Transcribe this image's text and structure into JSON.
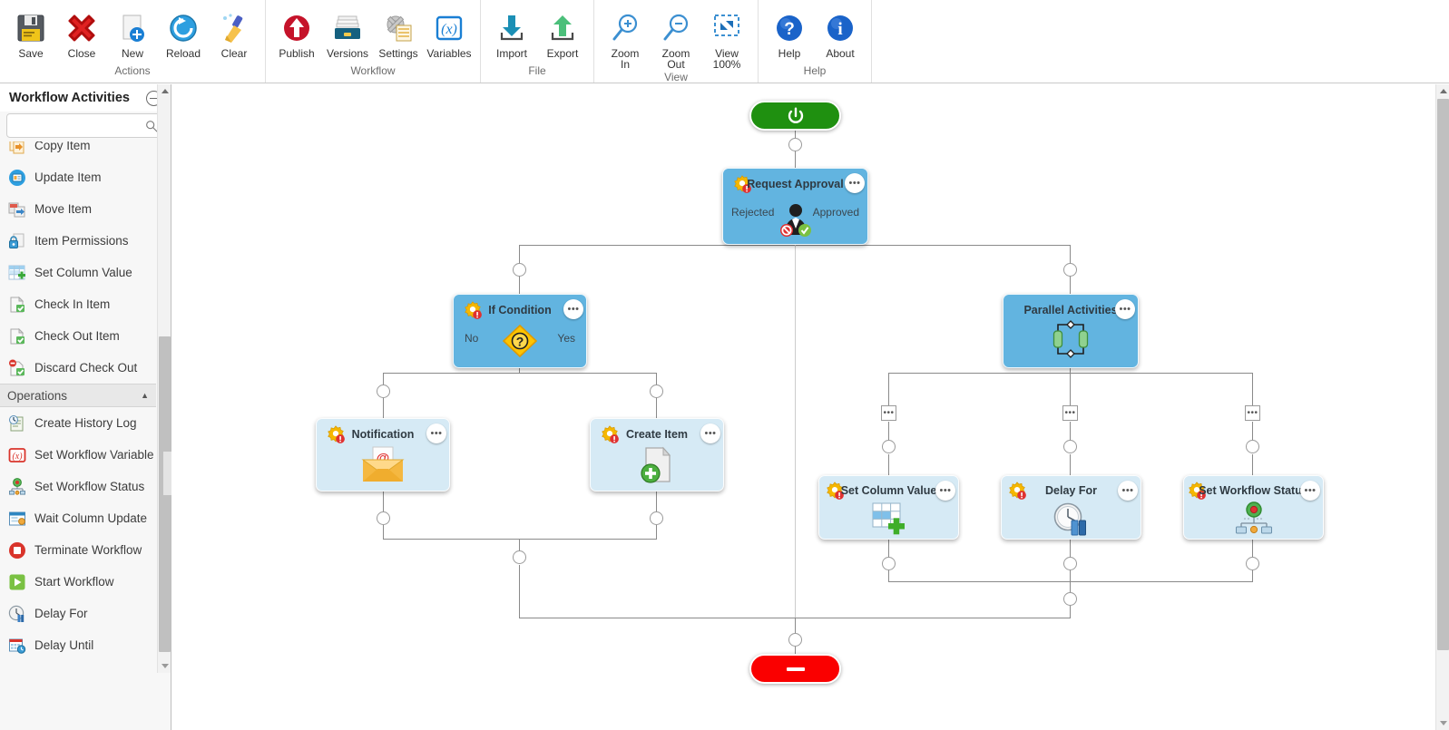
{
  "ribbon": {
    "groups": [
      {
        "name": "Actions",
        "label": "Actions",
        "buttons": [
          {
            "label": "Save",
            "icon": "save-icon"
          },
          {
            "label": "Close",
            "icon": "close-icon"
          },
          {
            "label": "New",
            "icon": "new-icon"
          },
          {
            "label": "Reload",
            "icon": "reload-icon"
          },
          {
            "label": "Clear",
            "icon": "clear-icon"
          }
        ]
      },
      {
        "name": "Workflow",
        "label": "Workflow",
        "buttons": [
          {
            "label": "Publish",
            "icon": "publish-icon"
          },
          {
            "label": "Versions",
            "icon": "versions-icon"
          },
          {
            "label": "Settings",
            "icon": "settings-icon"
          },
          {
            "label": "Variables",
            "icon": "variables-icon"
          }
        ]
      },
      {
        "name": "File",
        "label": "File",
        "buttons": [
          {
            "label": "Import",
            "icon": "import-icon"
          },
          {
            "label": "Export",
            "icon": "export-icon"
          }
        ]
      },
      {
        "name": "View",
        "label": "View",
        "buttons": [
          {
            "label": "Zoom\nIn",
            "icon": "zoom-in-icon"
          },
          {
            "label": "Zoom\nOut",
            "icon": "zoom-out-icon"
          },
          {
            "label": "View\n100%",
            "icon": "view-100-icon"
          }
        ]
      },
      {
        "name": "Help",
        "label": "Help",
        "buttons": [
          {
            "label": "Help",
            "icon": "help-icon"
          },
          {
            "label": "About",
            "icon": "about-icon"
          }
        ]
      }
    ]
  },
  "sidebar": {
    "title": "Workflow Activities",
    "search": {
      "value": "",
      "placeholder": ""
    },
    "items": [
      {
        "label": "Copy Item",
        "icon": "copy-item-icon",
        "type": "item"
      },
      {
        "label": "Update Item",
        "icon": "update-item-icon",
        "type": "item"
      },
      {
        "label": "Move Item",
        "icon": "move-item-icon",
        "type": "item"
      },
      {
        "label": "Item Permissions",
        "icon": "item-permissions-icon",
        "type": "item"
      },
      {
        "label": "Set Column Value",
        "icon": "set-column-value-icon",
        "type": "item"
      },
      {
        "label": "Check In Item",
        "icon": "check-in-item-icon",
        "type": "item"
      },
      {
        "label": "Check Out Item",
        "icon": "check-out-item-icon",
        "type": "item"
      },
      {
        "label": "Discard Check Out",
        "icon": "discard-check-out-icon",
        "type": "item"
      },
      {
        "label": "Operations",
        "icon": "collapse-caret-icon",
        "type": "group"
      },
      {
        "label": "Create History Log",
        "icon": "create-history-log-icon",
        "type": "item"
      },
      {
        "label": "Set Workflow Variable",
        "icon": "set-workflow-variable-icon",
        "type": "item"
      },
      {
        "label": "Set Workflow Status",
        "icon": "set-workflow-status-icon",
        "type": "item"
      },
      {
        "label": "Wait Column Update",
        "icon": "wait-column-update-icon",
        "type": "item"
      },
      {
        "label": "Terminate Workflow",
        "icon": "terminate-workflow-icon",
        "type": "item"
      },
      {
        "label": "Start Workflow",
        "icon": "start-workflow-icon",
        "type": "item"
      },
      {
        "label": "Delay For",
        "icon": "delay-for-icon",
        "type": "item"
      },
      {
        "label": "Delay Until",
        "icon": "delay-until-icon",
        "type": "item"
      }
    ]
  },
  "canvas": {
    "start_node": {
      "name": "start",
      "icon": "power-icon",
      "color": "#1f9010"
    },
    "stop_node": {
      "name": "stop",
      "icon": "stop-icon",
      "color": "#fa0000"
    },
    "menu_glyph": "•••",
    "nodes": [
      {
        "id": "request-approval",
        "title": "Request Approval",
        "icon": "request-approval-icon",
        "selected": true,
        "has_warning": true,
        "left_label": "Rejected",
        "right_label": "Approved"
      },
      {
        "id": "if-condition",
        "title": "If Condition",
        "icon": "if-condition-icon",
        "selected": true,
        "has_warning": true,
        "left_label": "No",
        "right_label": "Yes"
      },
      {
        "id": "parallel-activities",
        "title": "Parallel Activities",
        "icon": "parallel-activities-icon",
        "selected": true,
        "has_warning": false,
        "left_label": "",
        "right_label": ""
      },
      {
        "id": "notification",
        "title": "Notification",
        "icon": "notification-icon",
        "selected": false,
        "has_warning": true,
        "left_label": "",
        "right_label": ""
      },
      {
        "id": "create-item",
        "title": "Create Item",
        "icon": "create-item-icon",
        "selected": false,
        "has_warning": true,
        "left_label": "",
        "right_label": ""
      },
      {
        "id": "set-column-value",
        "title": "Set Column Value",
        "icon": "set-column-value-icon",
        "selected": false,
        "has_warning": true,
        "left_label": "",
        "right_label": ""
      },
      {
        "id": "delay-for",
        "title": "Delay For",
        "icon": "delay-for-icon",
        "selected": false,
        "has_warning": true,
        "left_label": "",
        "right_label": ""
      },
      {
        "id": "set-workflow-status",
        "title": "Set Workflow Status",
        "icon": "set-workflow-status-icon",
        "selected": false,
        "has_warning": true,
        "left_label": "",
        "right_label": ""
      }
    ]
  }
}
